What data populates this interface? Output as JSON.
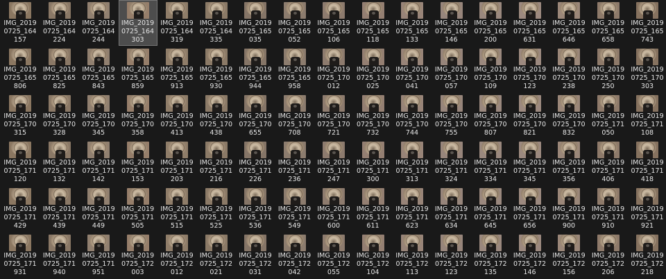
{
  "selected_index": 3,
  "thumb_tones": [
    "#8b7761",
    "#8a7866",
    "#918070",
    "#967e6a",
    "#8f7d69",
    "#8b7a67",
    "#857567",
    "#8c7c6e",
    "#8d7b6e",
    "#947f72",
    "#988478",
    "#97857b",
    "#9a887e",
    "#9c897f",
    "#9b8779",
    "#8e7a6a",
    "#86725f"
  ],
  "files": [
    "IMG_2019\n0725_164\n157",
    "IMG_2019\n0725_164\n224",
    "IMG_2019\n0725_164\n244",
    "IMG_2019\n0725_164\n303",
    "IMG_2019\n0725_164\n319",
    "IMG_2019\n0725_164\n335",
    "IMG_2019\n0725_165\n035",
    "IMG_2019\n0725_165\n052",
    "IMG_2019\n0725_165\n106",
    "IMG_2019\n0725_165\n118",
    "IMG_2019\n0725_165\n133",
    "IMG_2019\n0725_165\n146",
    "IMG_2019\n0725_165\n200",
    "IMG_2019\n0725_165\n631",
    "IMG_2019\n0725_165\n646",
    "IMG_2019\n0725_165\n658",
    "IMG_2019\n0725_165\n743",
    "IMG_2019\n0725_165\n806",
    "IMG_2019\n0725_165\n825",
    "IMG_2019\n0725_165\n843",
    "IMG_2019\n0725_165\n859",
    "IMG_2019\n0725_165\n913",
    "IMG_2019\n0725_165\n930",
    "IMG_2019\n0725_165\n944",
    "IMG_2019\n0725_165\n958",
    "IMG_2019\n0725_170\n012",
    "IMG_2019\n0725_170\n025",
    "IMG_2019\n0725_170\n041",
    "IMG_2019\n0725_170\n057",
    "IMG_2019\n0725_170\n109",
    "IMG_2019\n0725_170\n123",
    "IMG_2019\n0725_170\n238",
    "IMG_2019\n0725_170\n250",
    "IMG_2019\n0725_170\n303",
    "IMG_2019\n0725_170\n315",
    "IMG_2019\n0725_170\n328",
    "IMG_2019\n0725_170\n345",
    "IMG_2019\n0725_170\n358",
    "IMG_2019\n0725_170\n413",
    "IMG_2019\n0725_170\n438",
    "IMG_2019\n0725_170\n655",
    "IMG_2019\n0725_170\n708",
    "IMG_2019\n0725_170\n721",
    "IMG_2019\n0725_170\n732",
    "IMG_2019\n0725_170\n744",
    "IMG_2019\n0725_170\n755",
    "IMG_2019\n0725_170\n807",
    "IMG_2019\n0725_170\n821",
    "IMG_2019\n0725_170\n832",
    "IMG_2019\n0725_171\n050",
    "IMG_2019\n0725_171\n108",
    "IMG_2019\n0725_171\n120",
    "IMG_2019\n0725_171\n132",
    "IMG_2019\n0725_171\n142",
    "IMG_2019\n0725_171\n153",
    "IMG_2019\n0725_171\n203",
    "IMG_2019\n0725_171\n216",
    "IMG_2019\n0725_171\n226",
    "IMG_2019\n0725_171\n236",
    "IMG_2019\n0725_171\n247",
    "IMG_2019\n0725_171\n300",
    "IMG_2019\n0725_171\n313",
    "IMG_2019\n0725_171\n324",
    "IMG_2019\n0725_171\n334",
    "IMG_2019\n0725_171\n345",
    "IMG_2019\n0725_171\n356",
    "IMG_2019\n0725_171\n406",
    "IMG_2019\n0725_171\n418",
    "IMG_2019\n0725_171\n429",
    "IMG_2019\n0725_171\n439",
    "IMG_2019\n0725_171\n449",
    "IMG_2019\n0725_171\n505",
    "IMG_2019\n0725_171\n515",
    "IMG_2019\n0725_171\n525",
    "IMG_2019\n0725_171\n536",
    "IMG_2019\n0725_171\n549",
    "IMG_2019\n0725_171\n600",
    "IMG_2019\n0725_171\n611",
    "IMG_2019\n0725_171\n623",
    "IMG_2019\n0725_171\n634",
    "IMG_2019\n0725_171\n645",
    "IMG_2019\n0725_171\n656",
    "IMG_2019\n0725_171\n900",
    "IMG_2019\n0725_171\n910",
    "IMG_2019\n0725_171\n921",
    "IMG_2019\n0725_171\n931",
    "IMG_2019\n0725_171\n940",
    "IMG_2019\n0725_171\n951",
    "IMG_2019\n0725_172\n003",
    "IMG_2019\n0725_172\n012",
    "IMG_2019\n0725_172\n021",
    "IMG_2019\n0725_172\n031",
    "IMG_2019\n0725_172\n042",
    "IMG_2019\n0725_172\n055",
    "IMG_2019\n0725_172\n104",
    "IMG_2019\n0725_172\n113",
    "IMG_2019\n0725_172\n123",
    "IMG_2019\n0725_172\n135",
    "IMG_2019\n0725_172\n146",
    "IMG_2019\n0725_172\n156",
    "IMG_2019\n0725_172\n206",
    "IMG_2019\n0725_172\n218"
  ]
}
